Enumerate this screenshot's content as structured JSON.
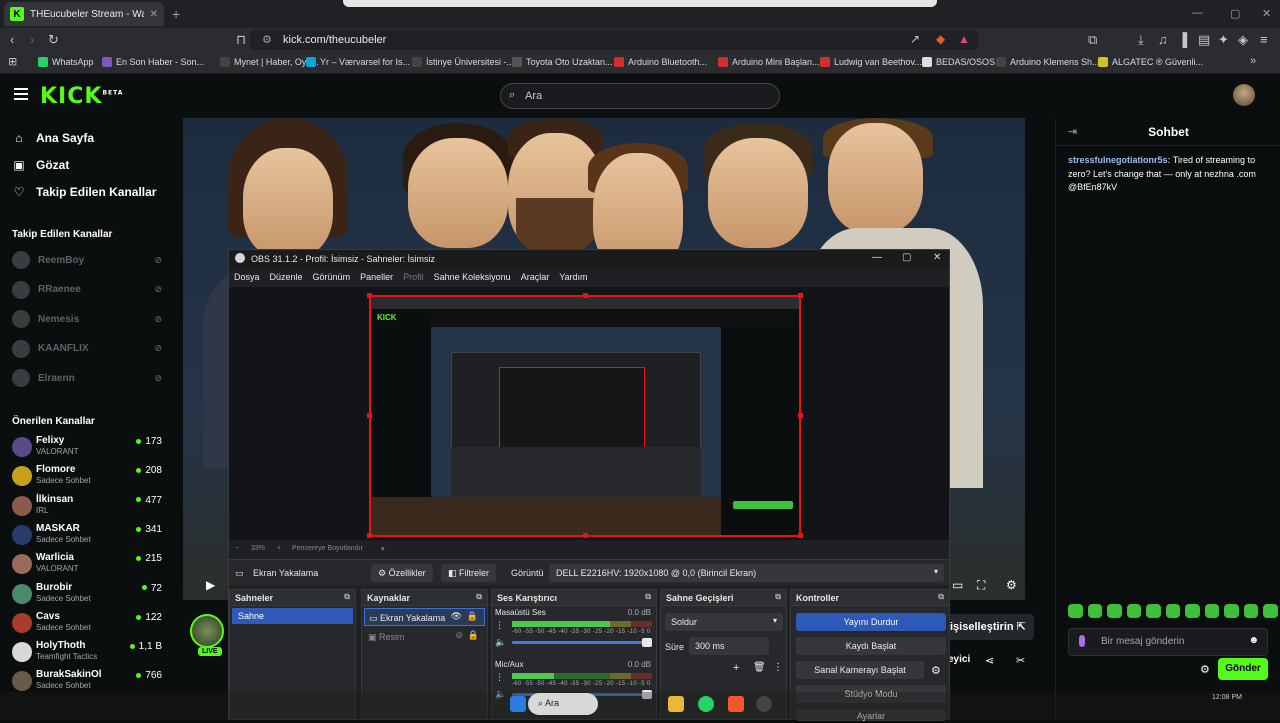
{
  "browser": {
    "tab_title": "THEucubeler Stream - Watch Liv",
    "url": "kick.com/theucubeler",
    "bookmarks": [
      {
        "label": "WhatsApp",
        "color": "#25d366"
      },
      {
        "label": "En Son Haber - Son...",
        "color": "#7e57c2"
      },
      {
        "label": "Mynet | Haber, Oyu...",
        "color": "#444444"
      },
      {
        "label": "Yr – Værvarsel for Is...",
        "color": "#0aa5d6"
      },
      {
        "label": "İstinye Üniversitesi -...",
        "color": "#444444"
      },
      {
        "label": "Toyota Oto Uzaktan...",
        "color": "#555555"
      },
      {
        "label": "Arduino Bluetooth...",
        "color": "#d32f2f"
      },
      {
        "label": "Arduino Mini Başlan...",
        "color": "#d32f2f"
      },
      {
        "label": "Ludwig van Beethov...",
        "color": "#d32f2f"
      },
      {
        "label": "BEDAS/OSOS",
        "color": "#dddddd"
      },
      {
        "label": "Arduino Klemens Sh...",
        "color": "#444444"
      },
      {
        "label": "ALGATEC ® Güvenli...",
        "color": "#d4c21a"
      }
    ]
  },
  "kick": {
    "logo": "KICK",
    "logo_beta": "BETA",
    "search_placeholder": "Ara",
    "nav": [
      {
        "label": "Ana Sayfa",
        "icon": "home-icon",
        "glyph": "⌂"
      },
      {
        "label": "Gözat",
        "icon": "browse-icon",
        "glyph": "▣"
      },
      {
        "label": "Takip Edilen Kanallar",
        "icon": "heart-icon",
        "glyph": "♡"
      }
    ],
    "followed_header": "Takip Edilen Kanallar",
    "followed": [
      "ReemBoy",
      "RRaenee",
      "Nemesis",
      "KAANFLIX",
      "Elraenn"
    ],
    "recommended_header": "Önerilen Kanallar",
    "recommended": [
      {
        "name": "Felixy",
        "category": "VALORANT",
        "viewers": "173",
        "color": "#5a4a8a"
      },
      {
        "name": "Flomore",
        "category": "Sadece Sohbet",
        "viewers": "208",
        "color": "#c9a01a"
      },
      {
        "name": "İlkinsan",
        "category": "IRL",
        "viewers": "477",
        "color": "#8a5a4a"
      },
      {
        "name": "MASKAR",
        "category": "Sadece Sohbet",
        "viewers": "341",
        "color": "#2a3b6a"
      },
      {
        "name": "Warlicia",
        "category": "VALORANT",
        "viewers": "215",
        "color": "#9a6a5a"
      },
      {
        "name": "Burobir",
        "category": "Sadece Sohbet",
        "viewers": "72",
        "color": "#4a8a6a"
      },
      {
        "name": "Cavs",
        "category": "Sadece Sohbet",
        "viewers": "122",
        "color": "#aa3a2a"
      },
      {
        "name": "HolyThoth",
        "category": "Teamfight Tactics",
        "viewers": "1,1 B",
        "color": "#d8d8d8"
      },
      {
        "name": "BurakSakinOl",
        "category": "Sadece Sohbet",
        "viewers": "766",
        "color": "#6a5a4a"
      }
    ],
    "live_badge": "LIVE",
    "follow_label": "işiselleştirin",
    "share_label": "eyici",
    "chat": {
      "title": "Sohbet",
      "message_user": "stressfulnegotiationr5s:",
      "message_text": " Tired of streaming to zero? Let's change that — only at nezhna .com @BfEn87kV",
      "input_placeholder": "Bir mesaj gönderin",
      "send_label": "Gönder"
    }
  },
  "obs": {
    "title": "OBS 31.1.2 - Profil: İsimsiz - Sahneler: İsimsiz",
    "menu": [
      "Dosya",
      "Düzenle",
      "Görünüm",
      "Paneller",
      "Profil",
      "Sahne Koleksiyonu",
      "Araçlar",
      "Yardım"
    ],
    "zoom": "33%",
    "zoom_mode": "Pencereye Boyutlandır",
    "source_name": "Ekran Yakalama",
    "properties_label": "Özellikler",
    "filters_label": "Filtreler",
    "display_label": "Görüntü",
    "display_value": "DELL E2216HV: 1920x1080 @ 0,0 (Birincil Ekran)",
    "scenes_title": "Sahneler",
    "scenes": [
      "Sahne"
    ],
    "sources_title": "Kaynaklar",
    "sources": [
      "Ekran Yakalama",
      "Resim"
    ],
    "mixer_title": "Ses Karıştırıcı",
    "mixer": [
      {
        "name": "Masaüstü Ses",
        "db": "0.0 dB",
        "level": 0.7
      },
      {
        "name": "Mic/Aux",
        "db": "0.0 dB",
        "level": 0.3
      }
    ],
    "meter_scale": "-60 -55 -50 -45 -40 -35 -30 -25 -20 -15 -10 -5 0",
    "transitions_title": "Sahne Geçişleri",
    "transition": "Soldur",
    "duration_label": "Süre",
    "duration": "300 ms",
    "controls_title": "Kontroller",
    "controls": [
      "Yayını Durdur",
      "Kaydı Başlat",
      "Sanal Kamerayı Başlat",
      "Stüdyo Modu",
      "Ayarlar"
    ]
  },
  "taskbar": {
    "search": "Ara",
    "time": "12:08 PM"
  }
}
